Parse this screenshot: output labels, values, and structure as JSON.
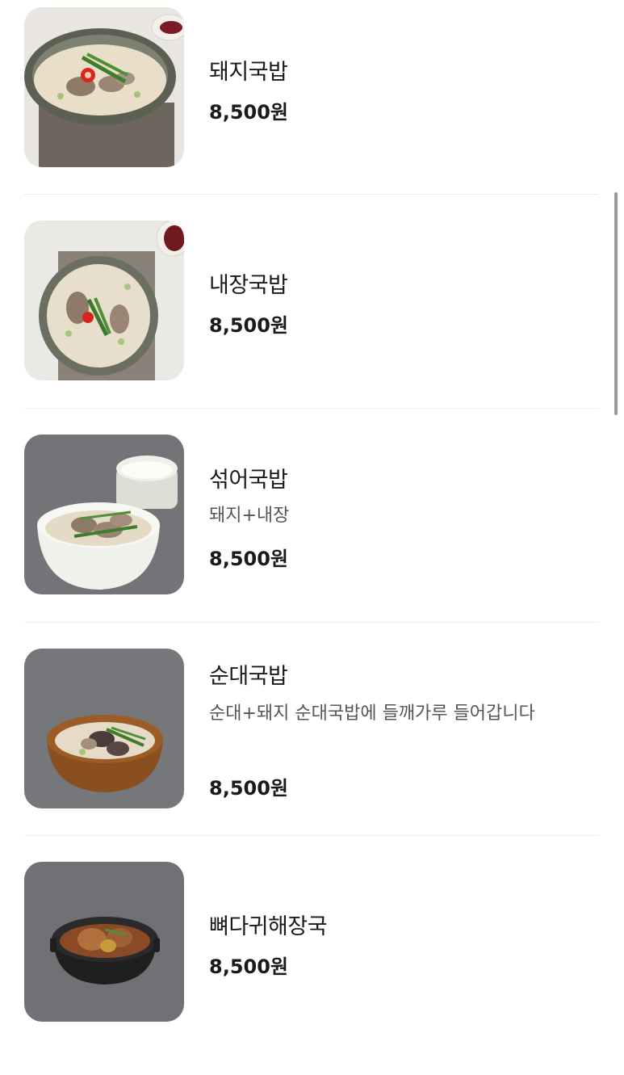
{
  "menu": {
    "items": [
      {
        "name": "돼지국밥",
        "price": "8,500원",
        "icon": "pork-gukbap-photo"
      },
      {
        "name": "내장국밥",
        "price": "8,500원",
        "icon": "offal-gukbap-photo"
      },
      {
        "name": "섞어국밥",
        "description": "돼지+내장",
        "price": "8,500원",
        "icon": "mixed-gukbap-photo"
      },
      {
        "name": "순대국밥",
        "description": "순대+돼지 순대국밥에 들깨가루 들어갑니다",
        "price": "8,500원",
        "icon": "sundae-gukbap-photo"
      },
      {
        "name": "뼈다귀해장국",
        "price": "8,500원",
        "icon": "pork-bone-soup-photo"
      }
    ]
  }
}
